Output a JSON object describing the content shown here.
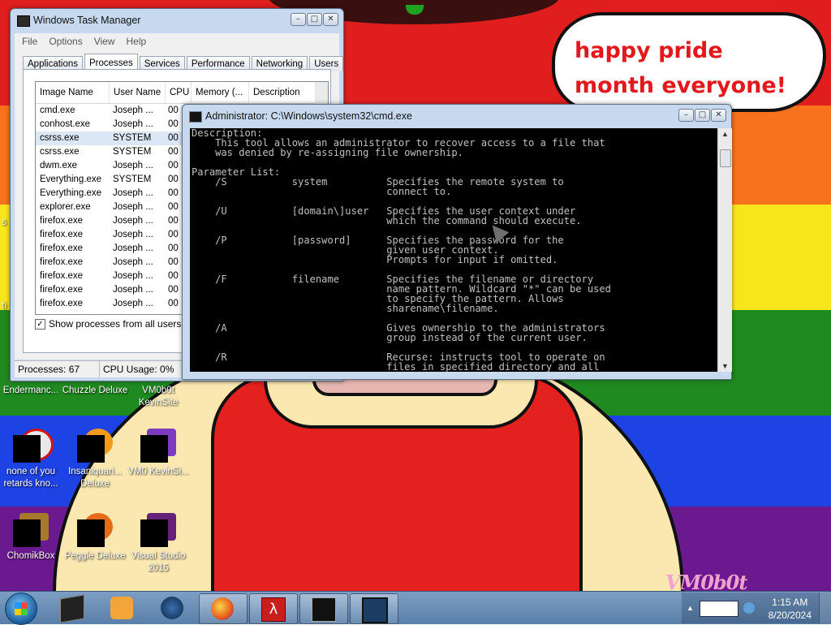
{
  "wallpaper": {
    "bubble_text": "happy pride month everyone!",
    "signature": "VM0b0t",
    "colors": {
      "red": "#e11e1e",
      "orange": "#f7721c",
      "yellow": "#f8e61c",
      "green": "#1f8a1f",
      "blue": "#1d43e4",
      "purple": "#6a1a8e"
    }
  },
  "desktop_icons": [
    {
      "label": "Endermanc...",
      "icon": "endermanch-icon"
    },
    {
      "label": "Chuzzle Deluxe",
      "icon": "chuzzle-icon"
    },
    {
      "label": "VM0b0t KevinSite",
      "icon": "kevinsite-icon"
    },
    {
      "label": "none of you retards kno...",
      "icon": "shortcut-icon"
    },
    {
      "label": "Insaniquari... Deluxe",
      "icon": "insaniquarium-icon"
    },
    {
      "label": "VM0 KevinSi...",
      "icon": "kevinsite2-icon"
    },
    {
      "label": "ChomikBox",
      "icon": "chomikbox-icon"
    },
    {
      "label": "Peggle Deluxe",
      "icon": "peggle-icon"
    },
    {
      "label": "Visual Studio 2015",
      "icon": "visual-studio-icon"
    }
  ],
  "edge_fragments": {
    "left_a": "s",
    "left_b": "ti"
  },
  "task_manager": {
    "title": "Windows Task Manager",
    "menu": [
      "File",
      "Options",
      "View",
      "Help"
    ],
    "tabs": [
      "Applications",
      "Processes",
      "Services",
      "Performance",
      "Networking",
      "Users"
    ],
    "active_tab": "Processes",
    "columns": [
      "Image Name",
      "User Name",
      "CPU",
      "Memory (...",
      "Description"
    ],
    "rows": [
      {
        "name": "cmd.exe",
        "user": "Joseph ...",
        "cpu": "00"
      },
      {
        "name": "conhost.exe",
        "user": "Joseph ...",
        "cpu": "00"
      },
      {
        "name": "csrss.exe",
        "user": "SYSTEM",
        "cpu": "00"
      },
      {
        "name": "csrss.exe",
        "user": "SYSTEM",
        "cpu": "00"
      },
      {
        "name": "dwm.exe",
        "user": "Joseph ...",
        "cpu": "00"
      },
      {
        "name": "Everything.exe",
        "user": "SYSTEM",
        "cpu": "00"
      },
      {
        "name": "Everything.exe",
        "user": "Joseph ...",
        "cpu": "00"
      },
      {
        "name": "explorer.exe",
        "user": "Joseph ...",
        "cpu": "00"
      },
      {
        "name": "firefox.exe",
        "user": "Joseph ...",
        "cpu": "00"
      },
      {
        "name": "firefox.exe",
        "user": "Joseph ...",
        "cpu": "00"
      },
      {
        "name": "firefox.exe",
        "user": "Joseph ...",
        "cpu": "00"
      },
      {
        "name": "firefox.exe",
        "user": "Joseph ...",
        "cpu": "00"
      },
      {
        "name": "firefox.exe",
        "user": "Joseph ...",
        "cpu": "00"
      },
      {
        "name": "firefox.exe",
        "user": "Joseph ...",
        "cpu": "00"
      },
      {
        "name": "firefox.exe",
        "user": "Joseph ...",
        "cpu": "00"
      }
    ],
    "selected_row": 2,
    "show_all_users_label": "Show processes from all users",
    "show_all_users_checked": true,
    "status_processes": "Processes: 67",
    "status_cpu": "CPU Usage: 0%"
  },
  "cmd": {
    "title": "Administrator: C:\\Windows\\system32\\cmd.exe",
    "lines": [
      "Description:",
      "    This tool allows an administrator to recover access to a file that",
      "    was denied by re-assigning file ownership.",
      "",
      "Parameter List:",
      "    /S           system          Specifies the remote system to",
      "                                 connect to.",
      "",
      "    /U           [domain\\]user   Specifies the user context under",
      "                                 which the command should execute.",
      "",
      "    /P           [password]      Specifies the password for the",
      "                                 given user context.",
      "                                 Prompts for input if omitted.",
      "",
      "    /F           filename        Specifies the filename or directory",
      "                                 name pattern. Wildcard \"*\" can be used",
      "                                 to specify the pattern. Allows",
      "                                 sharename\\filename.",
      "",
      "    /A                           Gives ownership to the administrators",
      "                                 group instead of the current user.",
      "",
      "    /R                           Recurse: instructs tool to operate on",
      "                                 files in specified directory and all"
    ]
  },
  "taskbar": {
    "items": [
      {
        "name": "taskbar-cmd-pinned",
        "icon": "console-icon"
      },
      {
        "name": "taskbar-media-player",
        "icon": "media-player-icon"
      },
      {
        "name": "taskbar-globe",
        "icon": "globe-icon"
      },
      {
        "name": "taskbar-firefox",
        "icon": "firefox-icon"
      },
      {
        "name": "taskbar-half-life",
        "icon": "lambda-icon"
      },
      {
        "name": "taskbar-cmd-window",
        "icon": "console-icon"
      },
      {
        "name": "taskbar-task-manager",
        "icon": "task-manager-icon"
      }
    ],
    "time": "1:15 AM",
    "date": "8/20/2024"
  }
}
